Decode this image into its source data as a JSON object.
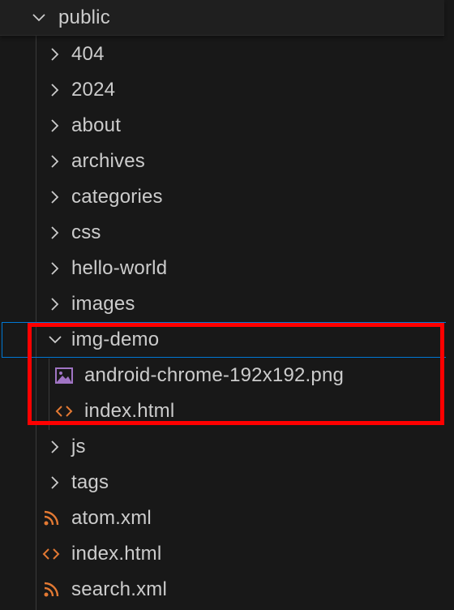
{
  "explorer": {
    "root": {
      "label": "public",
      "icon": "chevron-down-icon"
    },
    "items": [
      {
        "label": "404",
        "icon": "chevron-right-icon"
      },
      {
        "label": "2024",
        "icon": "chevron-right-icon"
      },
      {
        "label": "about",
        "icon": "chevron-right-icon"
      },
      {
        "label": "archives",
        "icon": "chevron-right-icon"
      },
      {
        "label": "categories",
        "icon": "chevron-right-icon"
      },
      {
        "label": "css",
        "icon": "chevron-right-icon"
      },
      {
        "label": "hello-world",
        "icon": "chevron-right-icon"
      },
      {
        "label": "images",
        "icon": "chevron-right-icon"
      },
      {
        "label": "img-demo",
        "icon": "chevron-down-icon",
        "expanded": true,
        "focused": true
      },
      {
        "label": "android-chrome-192x192.png",
        "icon": "image-file-icon"
      },
      {
        "label": "index.html",
        "icon": "html-file-icon"
      },
      {
        "label": "js",
        "icon": "chevron-right-icon"
      },
      {
        "label": "tags",
        "icon": "chevron-right-icon"
      },
      {
        "label": "atom.xml",
        "icon": "rss-file-icon"
      },
      {
        "label": "index.html",
        "icon": "html-file-icon"
      },
      {
        "label": "search.xml",
        "icon": "rss-file-icon"
      }
    ]
  },
  "colors": {
    "background": "#181818",
    "text": "#cccccc",
    "focus_outline": "#0078d4",
    "annotation": "#ff0000",
    "html_icon": "#e37933",
    "rss_icon": "#e37933",
    "image_icon": "#a074c4"
  }
}
